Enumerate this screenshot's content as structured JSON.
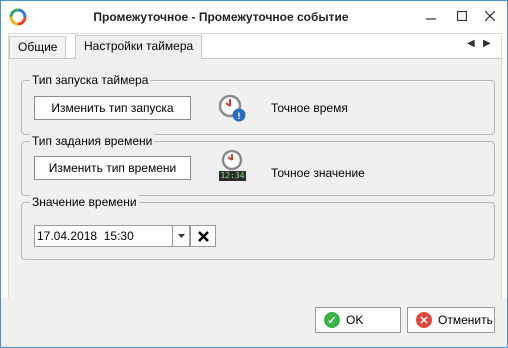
{
  "window": {
    "title": "Промежуточное - Промежуточное событие"
  },
  "tabs": [
    {
      "label": "Общие",
      "active": false
    },
    {
      "label": "Настройки таймера",
      "active": true
    }
  ],
  "groups": {
    "launch_type": {
      "label": "Тип запуска таймера",
      "button_label": "Изменить тип запуска",
      "icon": "alarm-clock-info-icon",
      "value": "Точное время"
    },
    "time_spec": {
      "label": "Тип задания времени",
      "button_label": "Изменить тип времени",
      "icon": "alarm-clock-digital-icon",
      "clock_digits": "12:34",
      "value": "Точное значение"
    },
    "time_value": {
      "label": "Значение времени",
      "datetime_value": "17.04.2018  15:30"
    }
  },
  "footer": {
    "ok_label": "OK",
    "cancel_label": "Отменить"
  },
  "colors": {
    "window_border": "#4a90d9",
    "ok_icon": "#3cb04a",
    "cancel_icon": "#e0483c",
    "clock_red": "#d23b2f",
    "info_blue": "#2a6ec0"
  }
}
